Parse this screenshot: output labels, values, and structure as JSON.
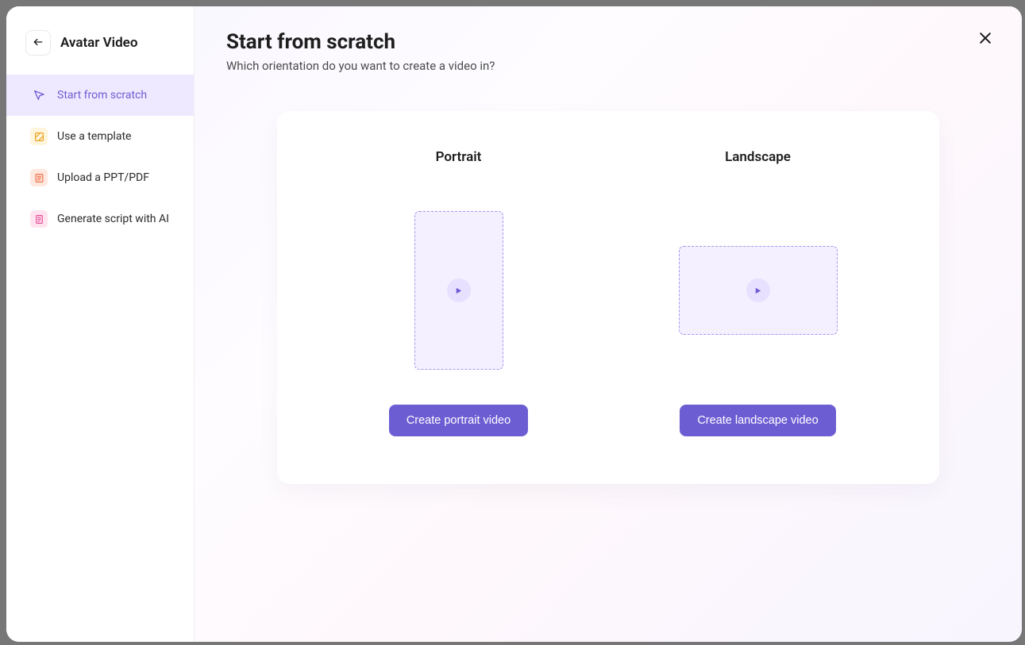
{
  "sidebar": {
    "title": "Avatar Video",
    "items": [
      {
        "label": "Start from scratch"
      },
      {
        "label": "Use a template"
      },
      {
        "label": "Upload a PPT/PDF"
      },
      {
        "label": "Generate script with AI"
      }
    ]
  },
  "content": {
    "title": "Start from scratch",
    "subtitle": "Which orientation do you want to create a video in?",
    "options": {
      "portrait": {
        "title": "Portrait",
        "button": "Create portrait video"
      },
      "landscape": {
        "title": "Landscape",
        "button": "Create landscape video"
      }
    }
  }
}
